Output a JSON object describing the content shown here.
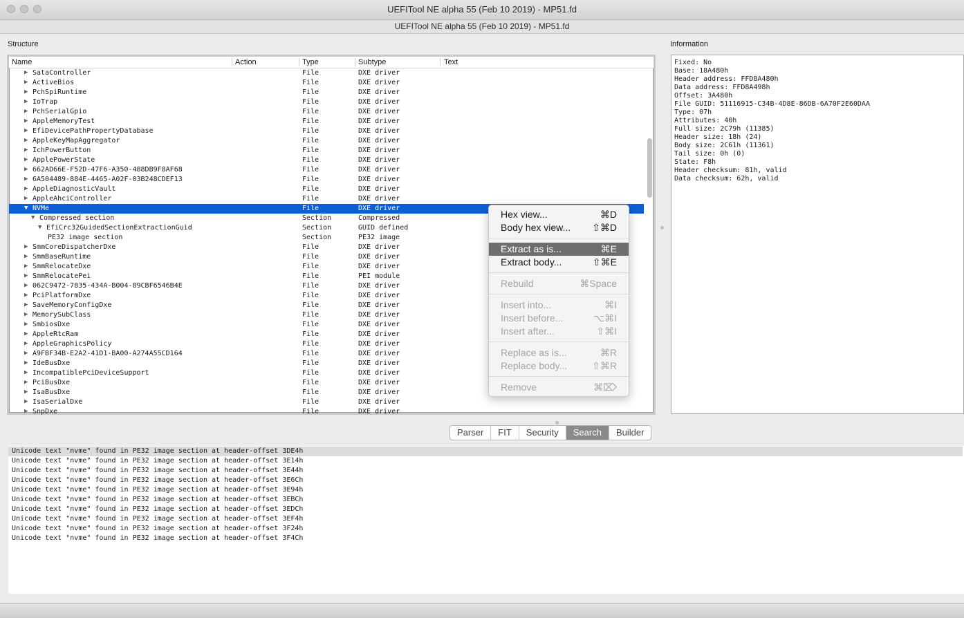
{
  "window": {
    "title": "UEFITool NE alpha 55 (Feb 10 2019) - MP51.fd",
    "subtitle": "UEFITool NE alpha 55 (Feb 10 2019) - MP51.fd"
  },
  "structure": {
    "label": "Structure",
    "columns": [
      "Name",
      "Action",
      "Type",
      "Subtype",
      "Text"
    ],
    "rows": [
      {
        "name": "SataController",
        "type": "File",
        "subtype": "DXE driver",
        "arrow": "▶",
        "indent": 0
      },
      {
        "name": "ActiveBios",
        "type": "File",
        "subtype": "DXE driver",
        "arrow": "▶",
        "indent": 0
      },
      {
        "name": "PchSpiRuntime",
        "type": "File",
        "subtype": "DXE driver",
        "arrow": "▶",
        "indent": 0
      },
      {
        "name": "IoTrap",
        "type": "File",
        "subtype": "DXE driver",
        "arrow": "▶",
        "indent": 0
      },
      {
        "name": "PchSerialGpio",
        "type": "File",
        "subtype": "DXE driver",
        "arrow": "▶",
        "indent": 0
      },
      {
        "name": "AppleMemoryTest",
        "type": "File",
        "subtype": "DXE driver",
        "arrow": "▶",
        "indent": 0
      },
      {
        "name": "EfiDevicePathPropertyDatabase",
        "type": "File",
        "subtype": "DXE driver",
        "arrow": "▶",
        "indent": 0
      },
      {
        "name": "AppleKeyMapAggregator",
        "type": "File",
        "subtype": "DXE driver",
        "arrow": "▶",
        "indent": 0
      },
      {
        "name": "IchPowerButton",
        "type": "File",
        "subtype": "DXE driver",
        "arrow": "▶",
        "indent": 0
      },
      {
        "name": "ApplePowerState",
        "type": "File",
        "subtype": "DXE driver",
        "arrow": "▶",
        "indent": 0
      },
      {
        "name": "662AD66E-F52D-47F6-A350-488DB9F8AF68",
        "type": "File",
        "subtype": "DXE driver",
        "arrow": "▶",
        "indent": 0
      },
      {
        "name": "6A504489-884E-4465-A02F-03B248CDEF13",
        "type": "File",
        "subtype": "DXE driver",
        "arrow": "▶",
        "indent": 0
      },
      {
        "name": "AppleDiagnosticVault",
        "type": "File",
        "subtype": "DXE driver",
        "arrow": "▶",
        "indent": 0
      },
      {
        "name": "AppleAhciController",
        "type": "File",
        "subtype": "DXE driver",
        "arrow": "▶",
        "indent": 0
      },
      {
        "name": "NVMe",
        "type": "File",
        "subtype": "DXE driver",
        "arrow": "▼",
        "indent": 0,
        "selected": true
      },
      {
        "name": "Compressed section",
        "type": "Section",
        "subtype": "Compressed",
        "arrow": "▼",
        "indent": 1
      },
      {
        "name": "EfiCrc32GuidedSectionExtractionGuid",
        "type": "Section",
        "subtype": "GUID defined",
        "arrow": "▼",
        "indent": 2
      },
      {
        "name": "PE32 image section",
        "type": "Section",
        "subtype": "PE32 image",
        "arrow": "",
        "indent": 3
      },
      {
        "name": "SmmCoreDispatcherDxe",
        "type": "File",
        "subtype": "DXE driver",
        "arrow": "▶",
        "indent": 0
      },
      {
        "name": "SmmBaseRuntime",
        "type": "File",
        "subtype": "DXE driver",
        "arrow": "▶",
        "indent": 0
      },
      {
        "name": "SmmRelocateDxe",
        "type": "File",
        "subtype": "DXE driver",
        "arrow": "▶",
        "indent": 0
      },
      {
        "name": "SmmRelocatePei",
        "type": "File",
        "subtype": "PEI module",
        "arrow": "▶",
        "indent": 0
      },
      {
        "name": "062C9472-7835-434A-B004-89CBF6546B4E",
        "type": "File",
        "subtype": "DXE driver",
        "arrow": "▶",
        "indent": 0
      },
      {
        "name": "PciPlatformDxe",
        "type": "File",
        "subtype": "DXE driver",
        "arrow": "▶",
        "indent": 0
      },
      {
        "name": "SaveMemoryConfigDxe",
        "type": "File",
        "subtype": "DXE driver",
        "arrow": "▶",
        "indent": 0
      },
      {
        "name": "MemorySubClass",
        "type": "File",
        "subtype": "DXE driver",
        "arrow": "▶",
        "indent": 0
      },
      {
        "name": "SmbiosDxe",
        "type": "File",
        "subtype": "DXE driver",
        "arrow": "▶",
        "indent": 0
      },
      {
        "name": "AppleRtcRam",
        "type": "File",
        "subtype": "DXE driver",
        "arrow": "▶",
        "indent": 0
      },
      {
        "name": "AppleGraphicsPolicy",
        "type": "File",
        "subtype": "DXE driver",
        "arrow": "▶",
        "indent": 0
      },
      {
        "name": "A9FBF34B-E2A2-41D1-BA00-A274A55CD164",
        "type": "File",
        "subtype": "DXE driver",
        "arrow": "▶",
        "indent": 0
      },
      {
        "name": "IdeBusDxe",
        "type": "File",
        "subtype": "DXE driver",
        "arrow": "▶",
        "indent": 0
      },
      {
        "name": "IncompatiblePciDeviceSupport",
        "type": "File",
        "subtype": "DXE driver",
        "arrow": "▶",
        "indent": 0
      },
      {
        "name": "PciBusDxe",
        "type": "File",
        "subtype": "DXE driver",
        "arrow": "▶",
        "indent": 0
      },
      {
        "name": "IsaBusDxe",
        "type": "File",
        "subtype": "DXE driver",
        "arrow": "▶",
        "indent": 0
      },
      {
        "name": "IsaSerialDxe",
        "type": "File",
        "subtype": "DXE driver",
        "arrow": "▶",
        "indent": 0
      },
      {
        "name": "SnpDxe",
        "type": "File",
        "subtype": "DXE driver",
        "arrow": "▶",
        "indent": 0
      }
    ]
  },
  "information": {
    "label": "Information",
    "lines": [
      "Fixed: No",
      "Base: 18A480h",
      "Header address: FFD8A480h",
      "Data address: FFD8A498h",
      "Offset: 3A480h",
      "File GUID: 51116915-C34B-4D8E-86DB-6A70F2E60DAA",
      "Type: 07h",
      "Attributes: 40h",
      "Full size: 2C79h (11385)",
      "Header size: 18h (24)",
      "Body size: 2C61h (11361)",
      "Tail size: 0h (0)",
      "State: F8h",
      "Header checksum: 81h, valid",
      "Data checksum: 62h, valid"
    ]
  },
  "context_menu": {
    "groups": [
      [
        {
          "label": "Hex view...",
          "shortcut": "⌘D",
          "enabled": true
        },
        {
          "label": "Body hex view...",
          "shortcut": "⇧⌘D",
          "enabled": true
        }
      ],
      [
        {
          "label": "Extract as is...",
          "shortcut": "⌘E",
          "enabled": true,
          "highlighted": true
        },
        {
          "label": "Extract body...",
          "shortcut": "⇧⌘E",
          "enabled": true
        }
      ],
      [
        {
          "label": "Rebuild",
          "shortcut": "⌘Space",
          "enabled": false
        }
      ],
      [
        {
          "label": "Insert into...",
          "shortcut": "⌘I",
          "enabled": false
        },
        {
          "label": "Insert before...",
          "shortcut": "⌥⌘I",
          "enabled": false
        },
        {
          "label": "Insert after...",
          "shortcut": "⇧⌘I",
          "enabled": false
        }
      ],
      [
        {
          "label": "Replace as is...",
          "shortcut": "⌘R",
          "enabled": false
        },
        {
          "label": "Replace body...",
          "shortcut": "⇧⌘R",
          "enabled": false
        }
      ],
      [
        {
          "label": "Remove",
          "shortcut": "⌘⌦",
          "enabled": false
        }
      ]
    ]
  },
  "bottom_tabs": {
    "tabs": [
      "Parser",
      "FIT",
      "Security",
      "Search",
      "Builder"
    ],
    "active": "Search"
  },
  "search_results": [
    "Unicode text \"nvme\" found in PE32 image section at header-offset 3DE4h",
    "Unicode text \"nvme\" found in PE32 image section at header-offset 3E14h",
    "Unicode text \"nvme\" found in PE32 image section at header-offset 3E44h",
    "Unicode text \"nvme\" found in PE32 image section at header-offset 3E6Ch",
    "Unicode text \"nvme\" found in PE32 image section at header-offset 3E94h",
    "Unicode text \"nvme\" found in PE32 image section at header-offset 3EBCh",
    "Unicode text \"nvme\" found in PE32 image section at header-offset 3EDCh",
    "Unicode text \"nvme\" found in PE32 image section at header-offset 3EF4h",
    "Unicode text \"nvme\" found in PE32 image section at header-offset 3F24h",
    "Unicode text \"nvme\" found in PE32 image section at header-offset 3F4Ch"
  ]
}
